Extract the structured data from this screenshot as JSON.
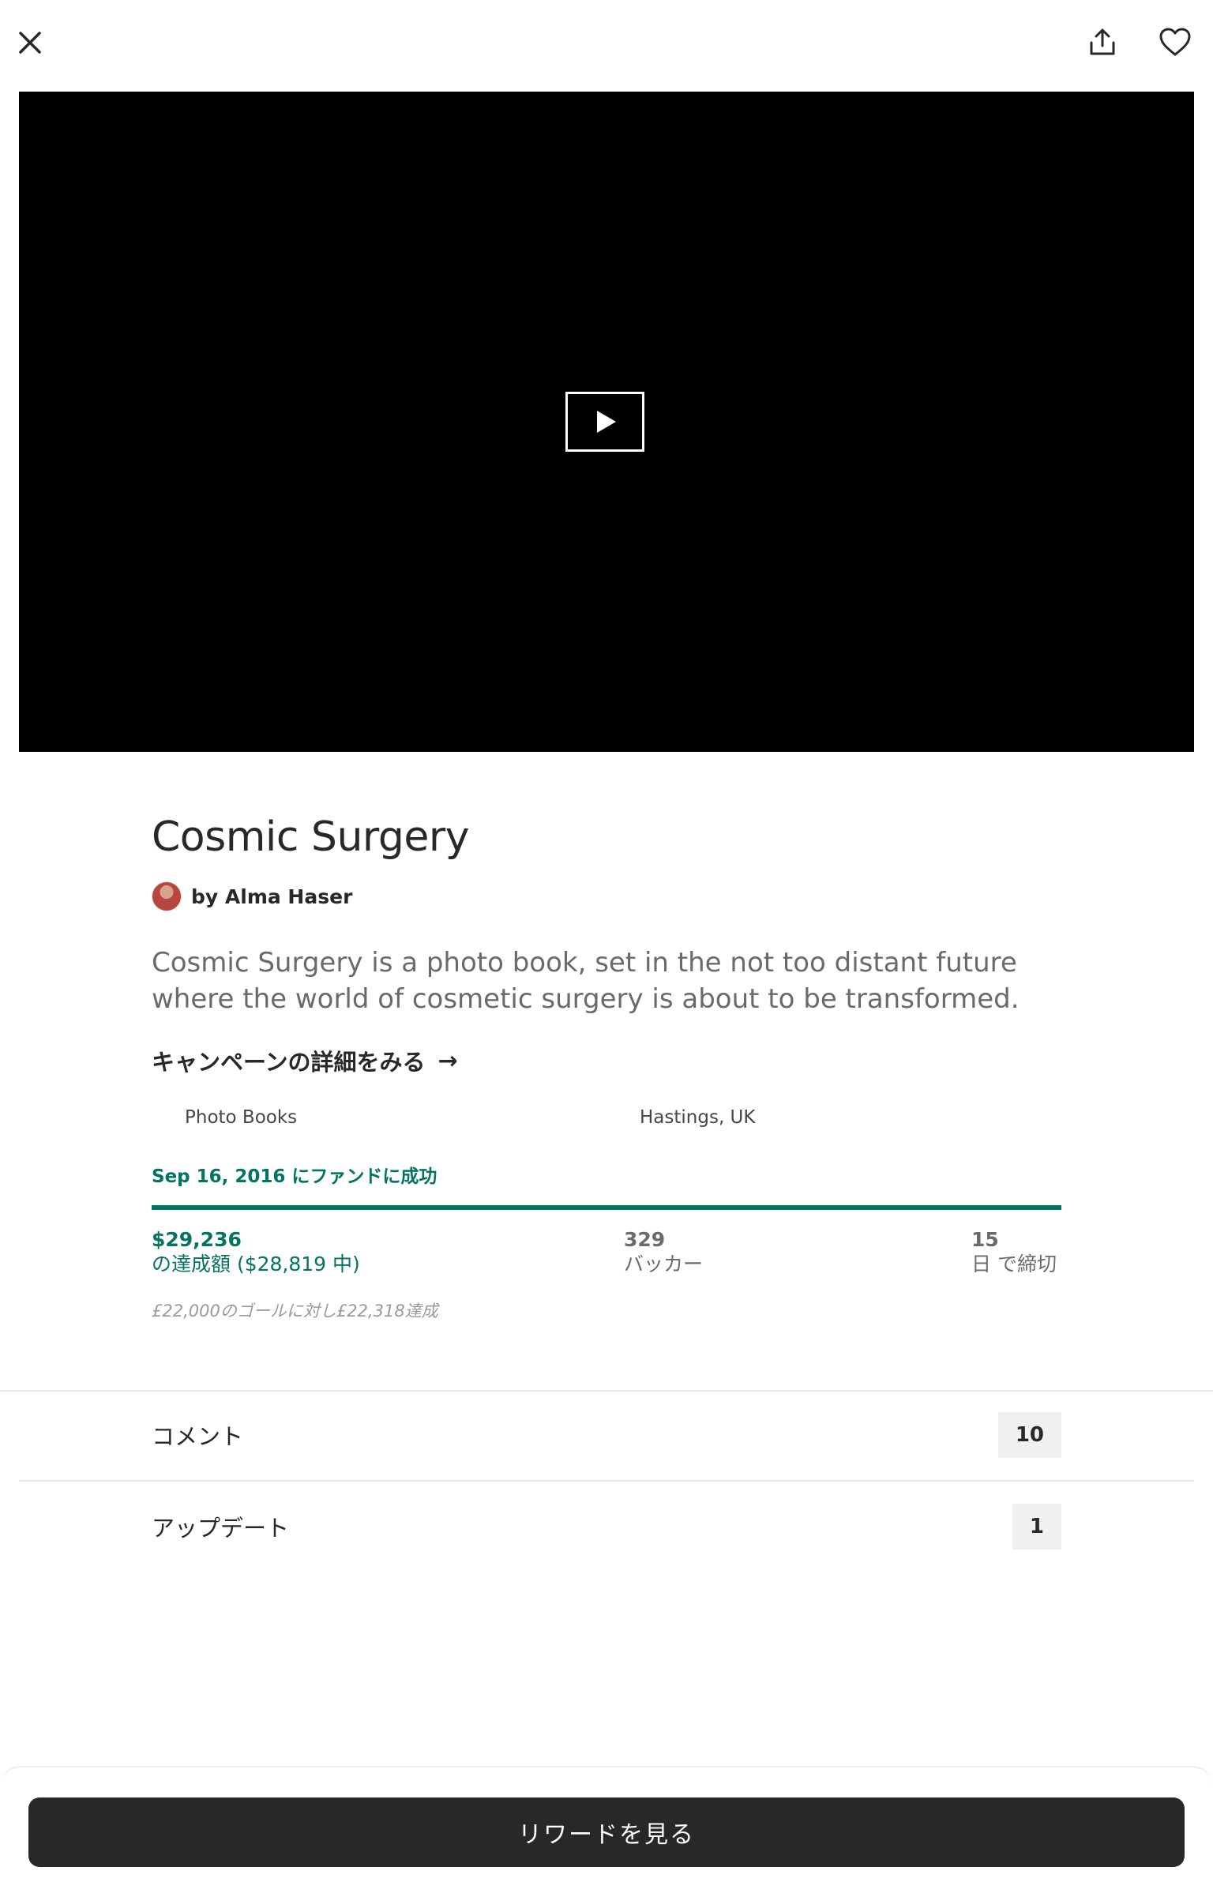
{
  "icons": {
    "close": "close-icon",
    "share": "share-icon",
    "favorite": "heart-icon",
    "play": "play-icon",
    "arrow": "arrow-right-icon"
  },
  "project": {
    "title": "Cosmic Surgery",
    "creator": "by Alma Haser",
    "blurb": "Cosmic Surgery is a photo book, set in the not too distant future where the world of cosmetic surgery is about to be transformed.",
    "details_link": "キャンペーンの詳細をみる",
    "category": "Photo Books",
    "location": "Hastings, UK",
    "funded_text": "Sep 16, 2016 にファンドに成功",
    "progress_percent": 100,
    "pledged": "$29,236",
    "pledged_label": "の達成額 ($28,819 中)",
    "backers": "329",
    "backers_label": "バッカー",
    "days": "15",
    "days_label": "日 で締切",
    "goal_note": "£22,000のゴールに対し£22,318達成"
  },
  "sections": {
    "comments_label": "コメント",
    "comments_count": "10",
    "updates_label": "アップデート",
    "updates_count": "1"
  },
  "footer": {
    "rewards_button": "リワードを見る"
  },
  "colors": {
    "accent": "#037362",
    "text": "#282828",
    "muted": "#6a6a6a",
    "button": "#282828"
  }
}
